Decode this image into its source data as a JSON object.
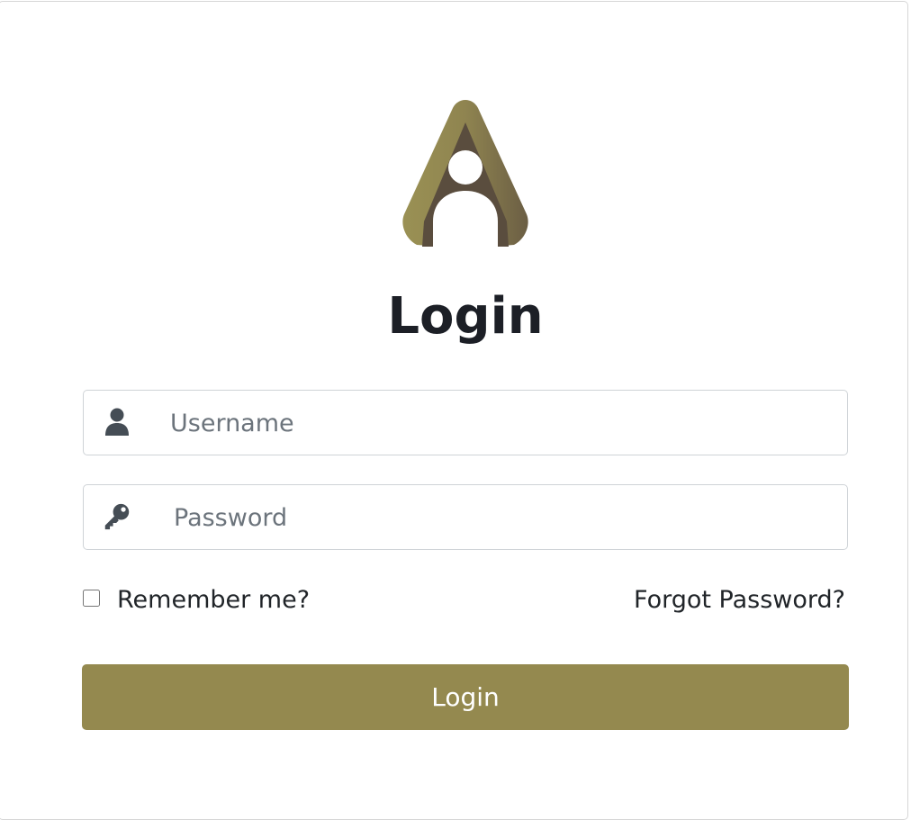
{
  "colors": {
    "accent": "#94894f",
    "logo_dark": "#5a4d3e",
    "logo_light": "#9a9154",
    "title": "#1c1f26",
    "icon": "#454d55"
  },
  "logo": {
    "icon": "a-person-logo"
  },
  "title": "Login",
  "username": {
    "placeholder": "Username",
    "value": "",
    "icon": "user-icon"
  },
  "password": {
    "placeholder": "Password",
    "value": "",
    "icon": "key-icon"
  },
  "remember": {
    "label": "Remember me?",
    "checked": false
  },
  "forgot_password": "Forgot Password?",
  "login_button": "Login"
}
